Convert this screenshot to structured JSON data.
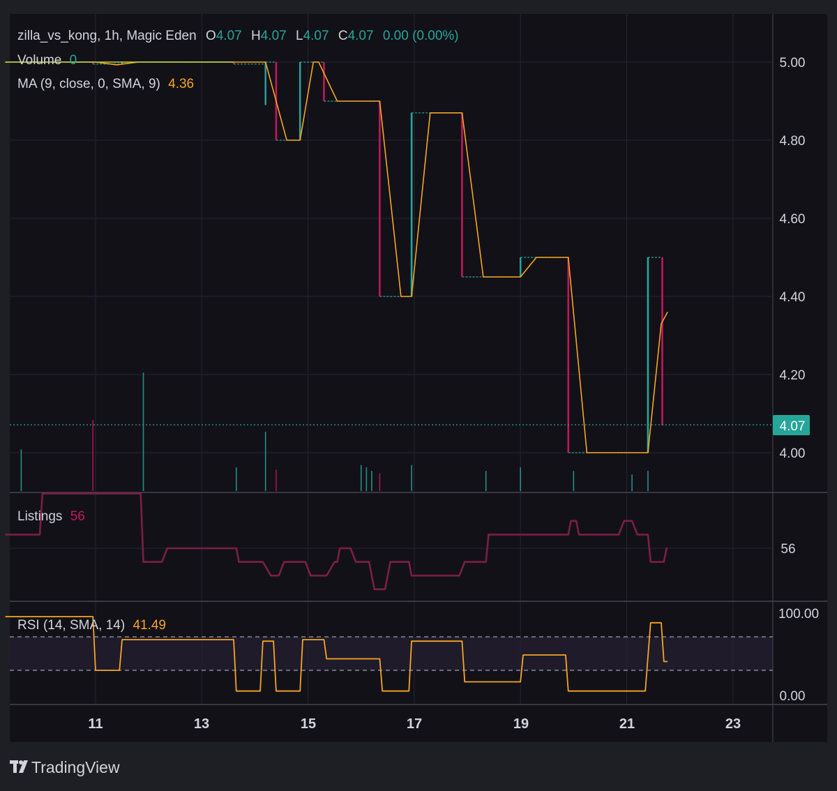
{
  "header": {
    "symbol": "zilla_vs_kong, 1h, Magic Eden",
    "ohlc": [
      {
        "key": "O",
        "value": "4.07"
      },
      {
        "key": "H",
        "value": "4.07"
      },
      {
        "key": "L",
        "value": "4.07"
      },
      {
        "key": "C",
        "value": "4.07"
      }
    ],
    "change": "0.00 (0.00%)"
  },
  "volume": {
    "label": "Volume",
    "value": "0"
  },
  "ma": {
    "label": "MA (9, close, 0, SMA, 9)",
    "value": "4.36"
  },
  "listings": {
    "label": "Listings",
    "value": "56",
    "axis_label": "56"
  },
  "rsi": {
    "label": "RSI (14, SMA, 14)",
    "value": "41.49",
    "axis_labels": [
      "100.00",
      "0.00"
    ]
  },
  "price_axis": {
    "ticks": [
      "5.00",
      "4.80",
      "4.60",
      "4.40",
      "4.20",
      "4.00"
    ]
  },
  "current_price": "4.07",
  "time_axis": {
    "ticks": [
      "11",
      "13",
      "15",
      "17",
      "19",
      "21",
      "23"
    ]
  },
  "watermark": "TradingView",
  "colors": {
    "background": "#131118",
    "up": "#26a69a",
    "down": "#c2185b",
    "ma": "#f5a623",
    "listings": "#7a1f45",
    "rsi": "#f5a623",
    "rsi_band": "#2a2438",
    "price_tag": "#26a69a"
  },
  "chart_data": [
    {
      "type": "line",
      "title": "zilla_vs_kong, 1h, Magic Eden",
      "x_unit": "day of month",
      "xlim": [
        9.3,
        22.8
      ],
      "ylim": [
        3.9,
        5.13
      ],
      "price_steps": [
        {
          "x": 9.3,
          "y": 5.0
        },
        {
          "x": 10.95,
          "y": 5.0
        },
        {
          "x": 10.95,
          "y": 4.995
        },
        {
          "x": 11.5,
          "y": 4.995
        },
        {
          "x": 11.5,
          "y": 5.0
        },
        {
          "x": 13.6,
          "y": 5.0
        },
        {
          "x": 13.6,
          "y": 4.995
        },
        {
          "x": 14.2,
          "y": 4.995
        },
        {
          "x": 14.2,
          "y": 5.0
        },
        {
          "x": 14.4,
          "y": 5.0
        },
        {
          "x": 14.4,
          "y": 4.8
        },
        {
          "x": 14.85,
          "y": 4.8
        },
        {
          "x": 14.85,
          "y": 5.0
        },
        {
          "x": 15.3,
          "y": 5.0
        },
        {
          "x": 15.3,
          "y": 4.9
        },
        {
          "x": 16.35,
          "y": 4.9
        },
        {
          "x": 16.35,
          "y": 4.4
        },
        {
          "x": 16.95,
          "y": 4.4
        },
        {
          "x": 16.95,
          "y": 4.87
        },
        {
          "x": 17.9,
          "y": 4.87
        },
        {
          "x": 17.9,
          "y": 4.45
        },
        {
          "x": 19.0,
          "y": 4.45
        },
        {
          "x": 19.0,
          "y": 4.5
        },
        {
          "x": 19.9,
          "y": 4.5
        },
        {
          "x": 19.9,
          "y": 4.0
        },
        {
          "x": 21.4,
          "y": 4.0
        },
        {
          "x": 21.4,
          "y": 4.5
        },
        {
          "x": 21.67,
          "y": 4.5
        },
        {
          "x": 21.67,
          "y": 4.07
        }
      ],
      "candles": [
        {
          "x": 14.2,
          "low": 4.89,
          "high": 5.0,
          "dir": "up"
        },
        {
          "x": 14.4,
          "low": 4.8,
          "high": 5.0,
          "dir": "down"
        },
        {
          "x": 14.85,
          "low": 4.8,
          "high": 5.0,
          "dir": "up"
        },
        {
          "x": 15.3,
          "low": 4.9,
          "high": 5.0,
          "dir": "down"
        },
        {
          "x": 16.35,
          "low": 4.4,
          "high": 4.9,
          "dir": "down"
        },
        {
          "x": 16.95,
          "low": 4.4,
          "high": 4.87,
          "dir": "up"
        },
        {
          "x": 17.9,
          "low": 4.45,
          "high": 4.87,
          "dir": "down"
        },
        {
          "x": 19.0,
          "low": 4.45,
          "high": 4.5,
          "dir": "up"
        },
        {
          "x": 19.9,
          "low": 4.0,
          "high": 4.5,
          "dir": "down"
        },
        {
          "x": 21.4,
          "low": 4.0,
          "high": 4.5,
          "dir": "up"
        },
        {
          "x": 21.67,
          "low": 4.07,
          "high": 4.5,
          "dir": "down"
        }
      ],
      "ma_line": [
        {
          "x": 9.3,
          "y": 5.0
        },
        {
          "x": 11.0,
          "y": 5.0
        },
        {
          "x": 11.4,
          "y": 4.993
        },
        {
          "x": 11.8,
          "y": 5.0
        },
        {
          "x": 14.2,
          "y": 5.0
        },
        {
          "x": 14.6,
          "y": 4.8
        },
        {
          "x": 14.85,
          "y": 4.8
        },
        {
          "x": 15.1,
          "y": 5.0
        },
        {
          "x": 15.2,
          "y": 5.0
        },
        {
          "x": 15.55,
          "y": 4.9
        },
        {
          "x": 16.35,
          "y": 4.9
        },
        {
          "x": 16.75,
          "y": 4.4
        },
        {
          "x": 16.95,
          "y": 4.4
        },
        {
          "x": 17.3,
          "y": 4.87
        },
        {
          "x": 17.9,
          "y": 4.87
        },
        {
          "x": 18.3,
          "y": 4.45
        },
        {
          "x": 19.0,
          "y": 4.45
        },
        {
          "x": 19.3,
          "y": 4.5
        },
        {
          "x": 19.9,
          "y": 4.5
        },
        {
          "x": 20.25,
          "y": 4.0
        },
        {
          "x": 21.4,
          "y": 4.0
        },
        {
          "x": 21.65,
          "y": 4.33
        },
        {
          "x": 21.77,
          "y": 4.36
        }
      ],
      "volume_bars": [
        {
          "x": 9.6,
          "v": 0.35,
          "dir": "up"
        },
        {
          "x": 10.95,
          "v": 0.6,
          "dir": "down"
        },
        {
          "x": 11.9,
          "v": 1.0,
          "dir": "up"
        },
        {
          "x": 13.65,
          "v": 0.2,
          "dir": "up"
        },
        {
          "x": 14.2,
          "v": 0.5,
          "dir": "up"
        },
        {
          "x": 14.4,
          "v": 0.18,
          "dir": "down"
        },
        {
          "x": 16.0,
          "v": 0.22,
          "dir": "up"
        },
        {
          "x": 16.1,
          "v": 0.2,
          "dir": "up"
        },
        {
          "x": 16.2,
          "v": 0.17,
          "dir": "up"
        },
        {
          "x": 16.35,
          "v": 0.15,
          "dir": "down"
        },
        {
          "x": 16.95,
          "v": 0.22,
          "dir": "up"
        },
        {
          "x": 18.35,
          "v": 0.17,
          "dir": "up"
        },
        {
          "x": 19.0,
          "v": 0.2,
          "dir": "up"
        },
        {
          "x": 20.0,
          "v": 0.17,
          "dir": "up"
        },
        {
          "x": 21.1,
          "v": 0.14,
          "dir": "up"
        },
        {
          "x": 21.4,
          "v": 0.17,
          "dir": "up"
        }
      ]
    },
    {
      "type": "line",
      "title": "Listings",
      "x_unit": "day of month",
      "xlim": [
        9.3,
        22.8
      ],
      "value_axis_label": "56",
      "levels": {
        "high": 72,
        "mid": 60,
        "base": 56,
        "low": 52,
        "min": 48
      },
      "steps": [
        {
          "x": 9.3,
          "y": 60
        },
        {
          "x": 9.95,
          "y": 60
        },
        {
          "x": 10.0,
          "y": 72
        },
        {
          "x": 11.85,
          "y": 72
        },
        {
          "x": 11.9,
          "y": 52
        },
        {
          "x": 12.25,
          "y": 52
        },
        {
          "x": 12.35,
          "y": 56
        },
        {
          "x": 13.65,
          "y": 56
        },
        {
          "x": 13.7,
          "y": 52
        },
        {
          "x": 14.15,
          "y": 52
        },
        {
          "x": 14.3,
          "y": 48
        },
        {
          "x": 14.45,
          "y": 48
        },
        {
          "x": 14.55,
          "y": 52
        },
        {
          "x": 14.95,
          "y": 52
        },
        {
          "x": 15.05,
          "y": 48
        },
        {
          "x": 15.35,
          "y": 48
        },
        {
          "x": 15.5,
          "y": 52
        },
        {
          "x": 15.55,
          "y": 52
        },
        {
          "x": 15.6,
          "y": 56
        },
        {
          "x": 15.8,
          "y": 56
        },
        {
          "x": 15.9,
          "y": 52
        },
        {
          "x": 16.15,
          "y": 52
        },
        {
          "x": 16.25,
          "y": 44
        },
        {
          "x": 16.45,
          "y": 44
        },
        {
          "x": 16.55,
          "y": 52
        },
        {
          "x": 16.9,
          "y": 52
        },
        {
          "x": 16.95,
          "y": 48
        },
        {
          "x": 17.85,
          "y": 48
        },
        {
          "x": 17.95,
          "y": 52
        },
        {
          "x": 18.35,
          "y": 52
        },
        {
          "x": 18.4,
          "y": 60
        },
        {
          "x": 19.9,
          "y": 60
        },
        {
          "x": 19.95,
          "y": 64
        },
        {
          "x": 20.05,
          "y": 64
        },
        {
          "x": 20.1,
          "y": 60
        },
        {
          "x": 20.85,
          "y": 60
        },
        {
          "x": 20.95,
          "y": 64
        },
        {
          "x": 21.1,
          "y": 64
        },
        {
          "x": 21.2,
          "y": 60
        },
        {
          "x": 21.4,
          "y": 60
        },
        {
          "x": 21.45,
          "y": 52
        },
        {
          "x": 21.7,
          "y": 52
        },
        {
          "x": 21.75,
          "y": 56
        },
        {
          "x": 21.77,
          "y": 56
        }
      ]
    },
    {
      "type": "line",
      "title": "RSI (14, SMA, 14)",
      "x_unit": "day of month",
      "xlim": [
        9.3,
        22.8
      ],
      "ylim": [
        0,
        100
      ],
      "bands": [
        70,
        30
      ],
      "steps": [
        {
          "x": 9.3,
          "y": 100
        },
        {
          "x": 10.95,
          "y": 100
        },
        {
          "x": 11.0,
          "y": 30
        },
        {
          "x": 11.45,
          "y": 30
        },
        {
          "x": 11.5,
          "y": 70
        },
        {
          "x": 13.6,
          "y": 70
        },
        {
          "x": 13.65,
          "y": 3
        },
        {
          "x": 14.1,
          "y": 3
        },
        {
          "x": 14.15,
          "y": 68
        },
        {
          "x": 14.35,
          "y": 68
        },
        {
          "x": 14.4,
          "y": 3
        },
        {
          "x": 14.85,
          "y": 3
        },
        {
          "x": 14.9,
          "y": 70
        },
        {
          "x": 15.3,
          "y": 70
        },
        {
          "x": 15.35,
          "y": 45
        },
        {
          "x": 16.35,
          "y": 45
        },
        {
          "x": 16.4,
          "y": 3
        },
        {
          "x": 16.9,
          "y": 3
        },
        {
          "x": 16.95,
          "y": 68
        },
        {
          "x": 17.9,
          "y": 68
        },
        {
          "x": 17.95,
          "y": 15
        },
        {
          "x": 19.0,
          "y": 15
        },
        {
          "x": 19.05,
          "y": 50
        },
        {
          "x": 19.85,
          "y": 50
        },
        {
          "x": 19.9,
          "y": 3
        },
        {
          "x": 21.35,
          "y": 3
        },
        {
          "x": 21.45,
          "y": 92
        },
        {
          "x": 21.65,
          "y": 92
        },
        {
          "x": 21.7,
          "y": 41.49
        },
        {
          "x": 21.77,
          "y": 41.49
        }
      ]
    }
  ]
}
